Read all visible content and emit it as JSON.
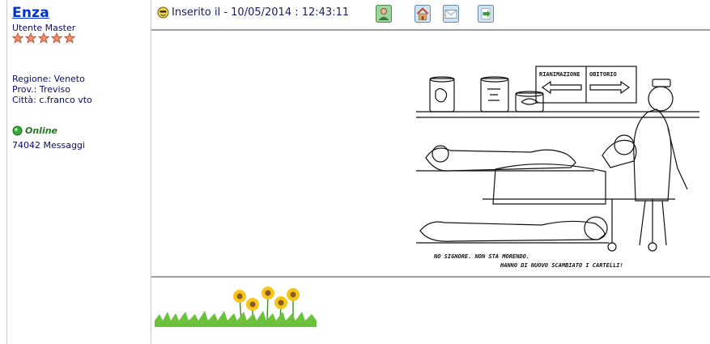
{
  "user": {
    "name": "Enza",
    "rank": "Utente Master",
    "stars": 5,
    "region": "Regione: Veneto",
    "province": "Prov.: Treviso",
    "city": "Città: c.franco vto",
    "status": "Online",
    "messages": "74042 Messaggi"
  },
  "post": {
    "posted_label": "Inserito il - 10/05/2014 : 12:43:11",
    "icons": [
      "profile-icon",
      "homepage-icon",
      "email-icon",
      "reply-quote-icon"
    ]
  },
  "cartoon": {
    "sign_left": "RIANIMAZIONE",
    "sign_right": "OBITORIO",
    "caption_1": "NO SIGNORE. NON STA MORENDO.",
    "caption_2": "HANNO DI NUOVO SCAMBIATO I CARTELLI!"
  },
  "colors": {
    "username": "#0033cc",
    "text": "#0a0a66",
    "online": "#1f7a1f",
    "divider": "#a0a0a0"
  }
}
